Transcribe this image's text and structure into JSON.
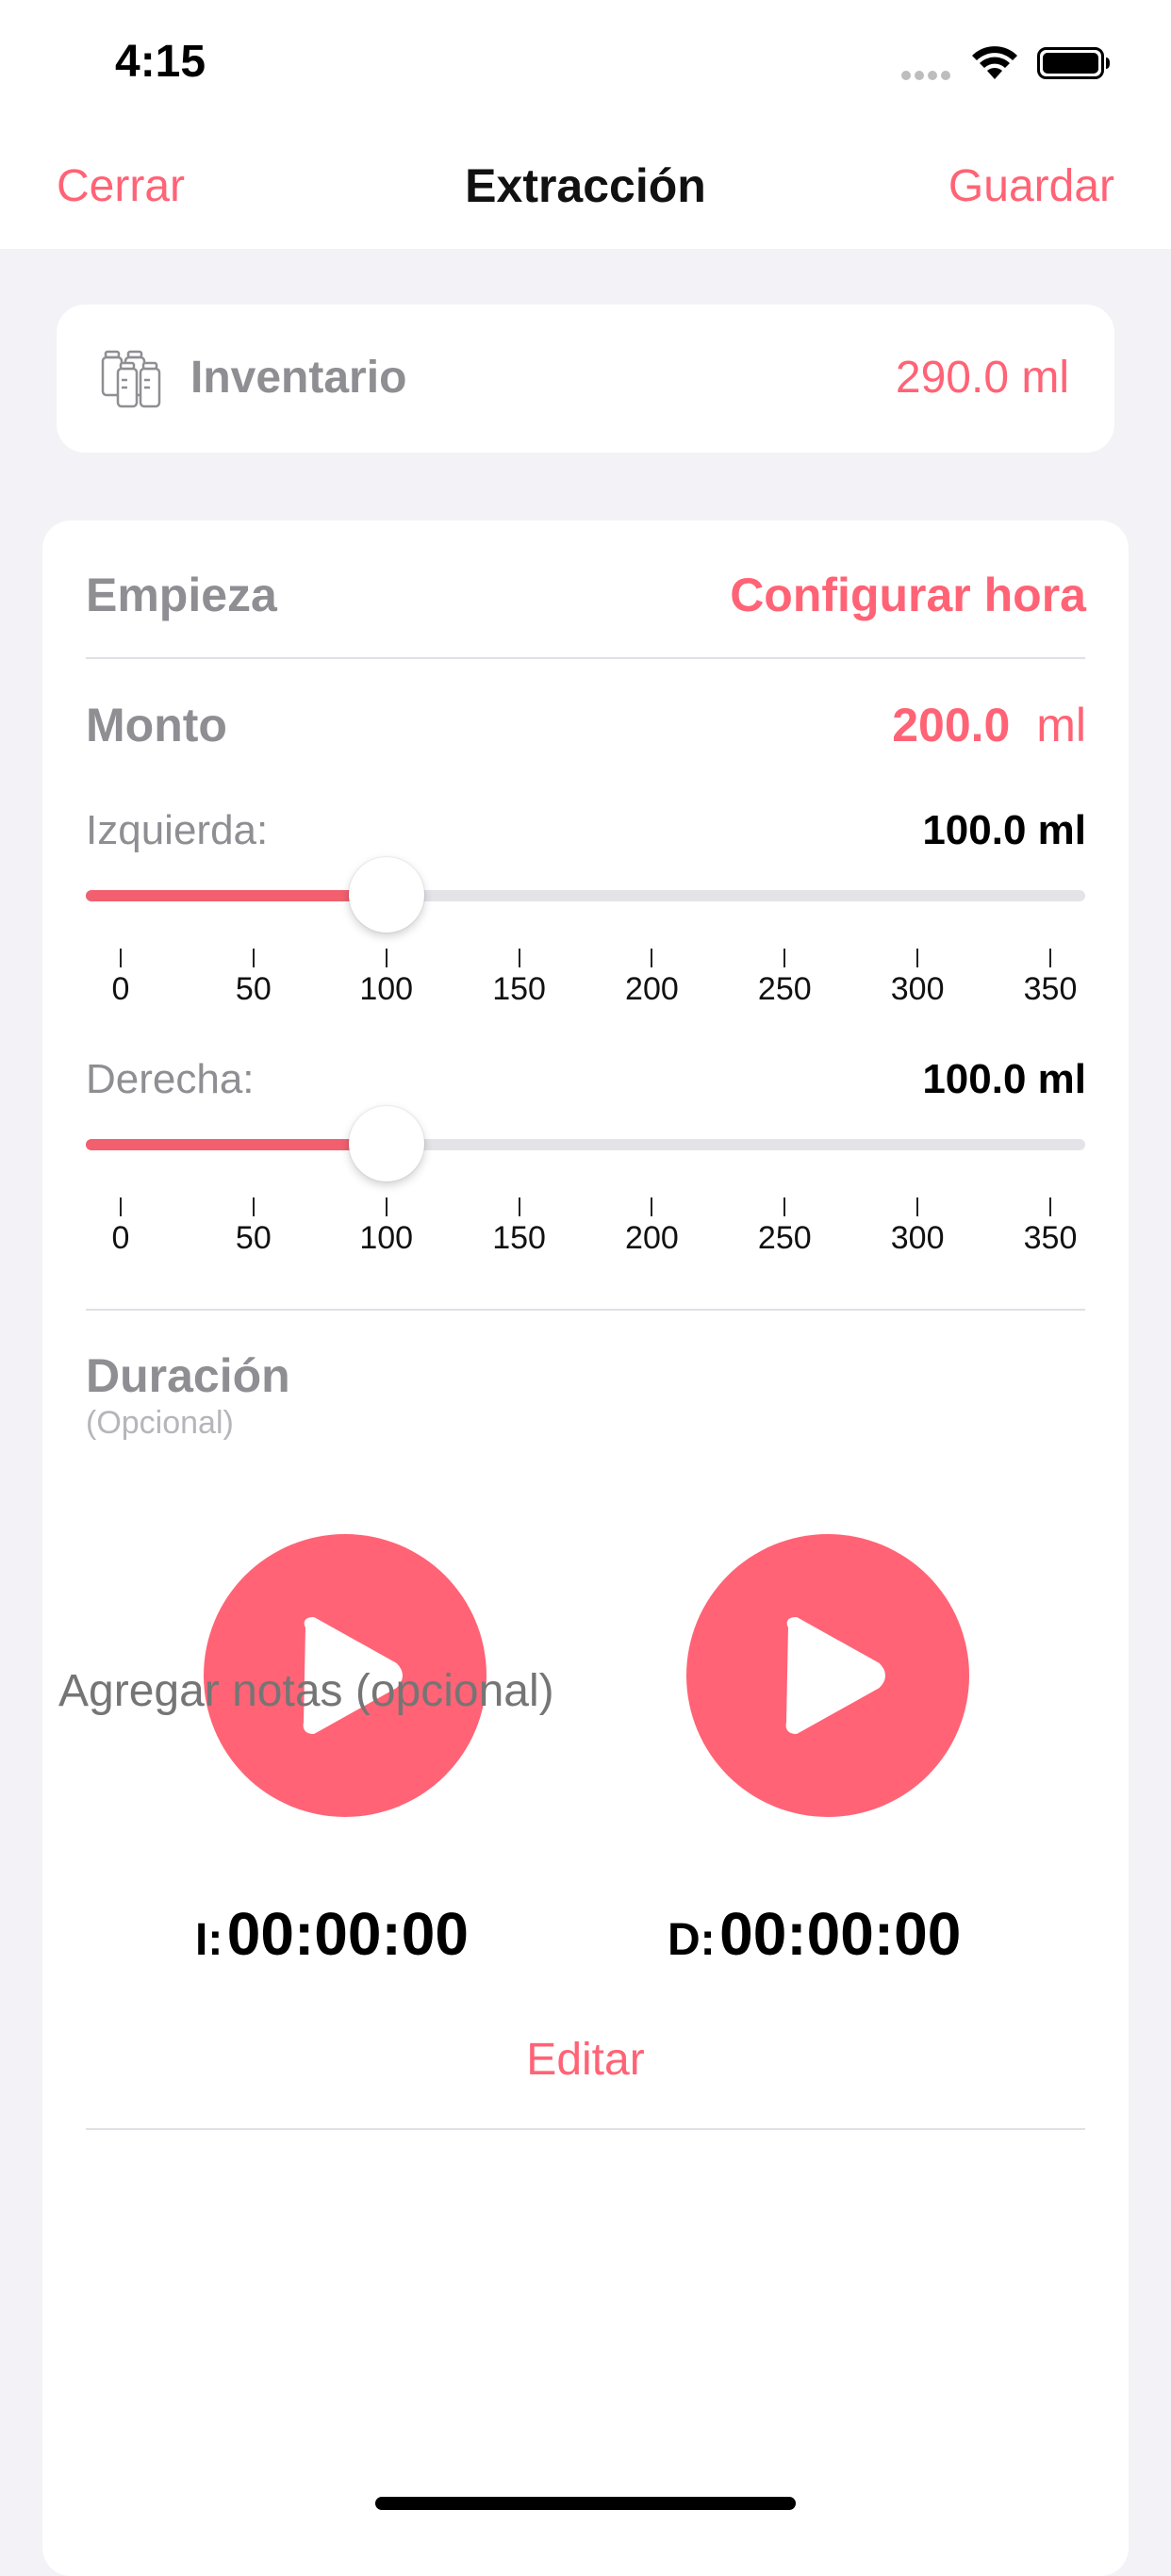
{
  "status_bar": {
    "time": "4:15"
  },
  "nav": {
    "close": "Cerrar",
    "title": "Extracción",
    "save": "Guardar"
  },
  "inventory": {
    "label": "Inventario",
    "value": "290.0 ml"
  },
  "start": {
    "label": "Empieza",
    "action": "Configurar hora"
  },
  "amount": {
    "label": "Monto",
    "value": "200.0",
    "unit": "ml"
  },
  "left": {
    "label": "Izquierda:",
    "value": "100.0 ml",
    "slider_value": 100,
    "slider_max": 350
  },
  "right": {
    "label": "Derecha:",
    "value": "100.0 ml",
    "slider_value": 100,
    "slider_max": 350
  },
  "ticks": [
    "0",
    "50",
    "100",
    "150",
    "200",
    "250",
    "300",
    "350"
  ],
  "duration": {
    "label": "Duración",
    "optional": "(Opcional)"
  },
  "timers": {
    "left": {
      "prefix": "I:",
      "value": "00:00:00"
    },
    "right": {
      "prefix": "D:",
      "value": "00:00:00"
    }
  },
  "edit": "Editar",
  "notes": {
    "placeholder": "Agregar notas (opcional)"
  },
  "colors": {
    "accent": "#FF6375",
    "secondary_text": "#8E8E93",
    "background": "#F2F2F7"
  }
}
